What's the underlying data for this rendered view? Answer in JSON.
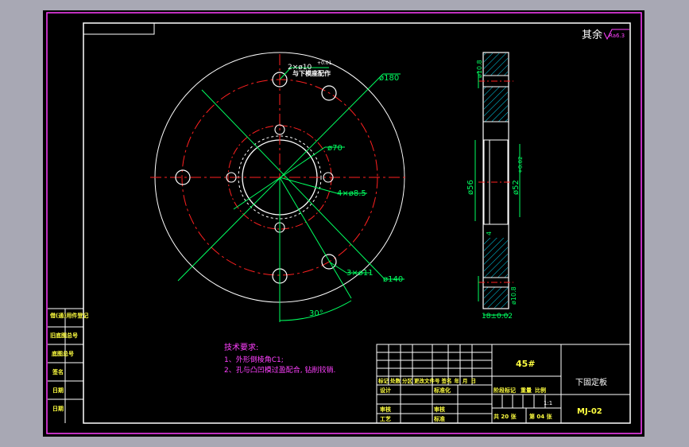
{
  "drawing": {
    "roughness_label": "其余",
    "roughness_value": "Ra6.3",
    "material": "45#",
    "part_name": "下固定板",
    "drawing_no": "MJ-02",
    "scale": "1:1",
    "sheet_total": "共 20 张",
    "sheet_no": "第 04 张"
  },
  "tech_notes": {
    "title": "技术要求:",
    "items": [
      "1、外形倒棱角C1;",
      "2、孔与凸凹模过盈配合, 钻削铰销."
    ]
  },
  "front_view": {
    "dims": {
      "pin_hole": "2×ø10",
      "pin_tol": "+0.01",
      "pin_note": "与下模座配作",
      "outer": "ø180",
      "bolt_circle": "ø140",
      "center_circle": "ø70",
      "small_holes": "4×ø8.5",
      "big_holes": "3×ø11",
      "angle": "30°"
    }
  },
  "side_view": {
    "dims": {
      "top_hole": "ø10.8",
      "d56": "ø56",
      "d52": "ø52",
      "d52_tol": "+0.02",
      "d4": "4",
      "bottom_hole": "ø10.8",
      "thickness": "18±0.02"
    }
  },
  "title_block": {
    "rev_headers": [
      "标记",
      "处数",
      "分区",
      "更改文件号",
      "签名",
      "年",
      "月",
      "日"
    ],
    "row_labels": [
      "设计",
      "审核",
      "工艺"
    ],
    "mid_labels": [
      "标准化",
      "",
      "审核",
      "标准"
    ],
    "stage_headers": [
      "阶段标记",
      "重量",
      "比例"
    ]
  },
  "side_stamps": [
    "借(通)用件登记",
    "旧底图总号",
    "底图总号",
    "签名",
    "日期",
    "日期"
  ],
  "colors": {
    "line": "#ffffff",
    "center": "#ff2020",
    "dim": "#00ff60",
    "text_yellow": "#ffff40",
    "text_magenta": "#ff40ff",
    "border": "#ff40ff",
    "hatch": "#00e0ff"
  }
}
